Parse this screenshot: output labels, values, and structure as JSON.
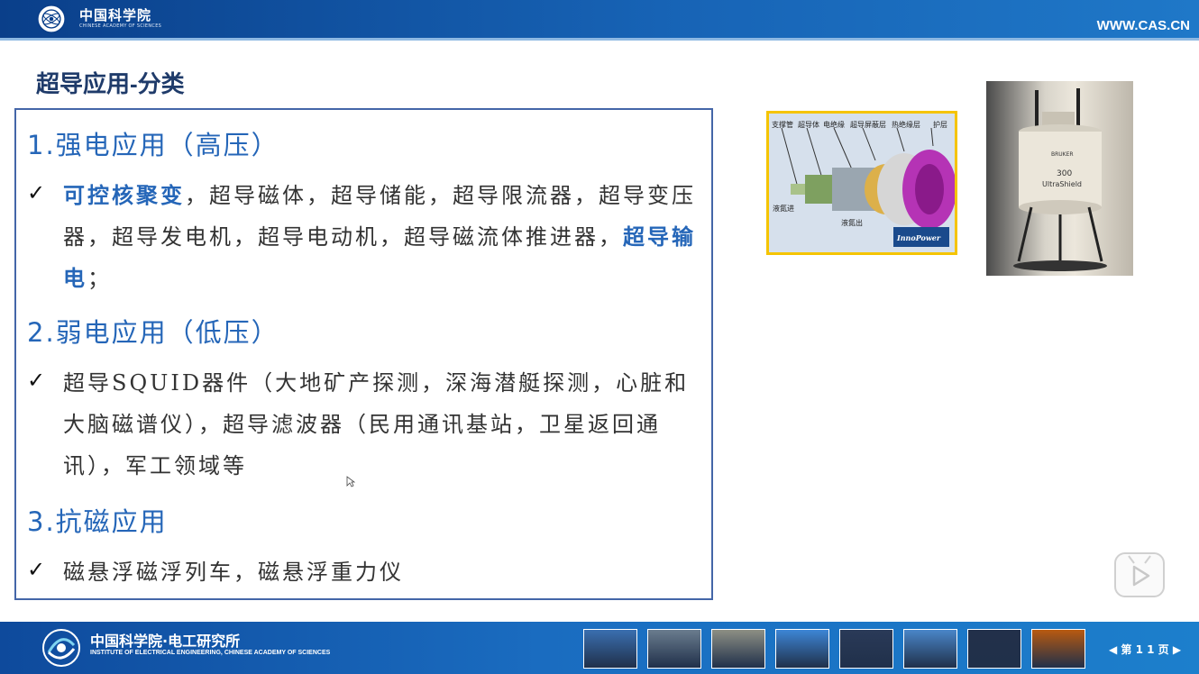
{
  "header": {
    "brand": "中国科学院",
    "brand_sub": "CHINESE ACADEMY OF SCIENCES",
    "url": "WWW.CAS.CN"
  },
  "slide": {
    "title": "超导应用-分类",
    "sections": [
      {
        "heading": "1.强电应用（高压）",
        "bullet": "✓",
        "text_highlight_1": "可控核聚变",
        "text_1": "，超导磁体，超导储能，超导限流器，超导变压器，超导发电机，超导电动机，超导磁流体推进器，",
        "text_highlight_2": "超导输电",
        "text_2": "；"
      },
      {
        "heading": "2.弱电应用（低压）",
        "bullet": "✓",
        "text": "超导SQUID器件（大地矿产探测，深海潜艇探测，心脏和大脑磁谱仪），超导滤波器（民用通讯基站，卫星返回通讯），军工领域等"
      },
      {
        "heading": "3.抗磁应用",
        "bullet": "✓",
        "text": "磁悬浮磁浮列车，磁悬浮重力仪"
      }
    ],
    "diagram": {
      "labels": [
        "支撑管",
        "超导体",
        "电绝缘",
        "超导屏蔽层",
        "热绝缘层",
        "护层"
      ],
      "inlet": "液氮进",
      "outlet": "液氮出",
      "brand": "InnoPower"
    },
    "magnet": {
      "brand": "BRUKER",
      "model": "300",
      "name": "UltraShield"
    }
  },
  "footer": {
    "org": "中国科学院·电工研究所",
    "org_en": "INSTITUTE OF ELECTRICAL ENGINEERING, CHINESE ACADEMY OF SCIENCES",
    "page": "◀ 第 1 1 页 ▶",
    "colors": {
      "thumb_colors": [
        "#3a6fb0",
        "#6a7c8e",
        "#8d8f84",
        "#3d86d6",
        "#2a3a58",
        "#4a86c8",
        "#22304a",
        "#b85a10"
      ]
    }
  }
}
